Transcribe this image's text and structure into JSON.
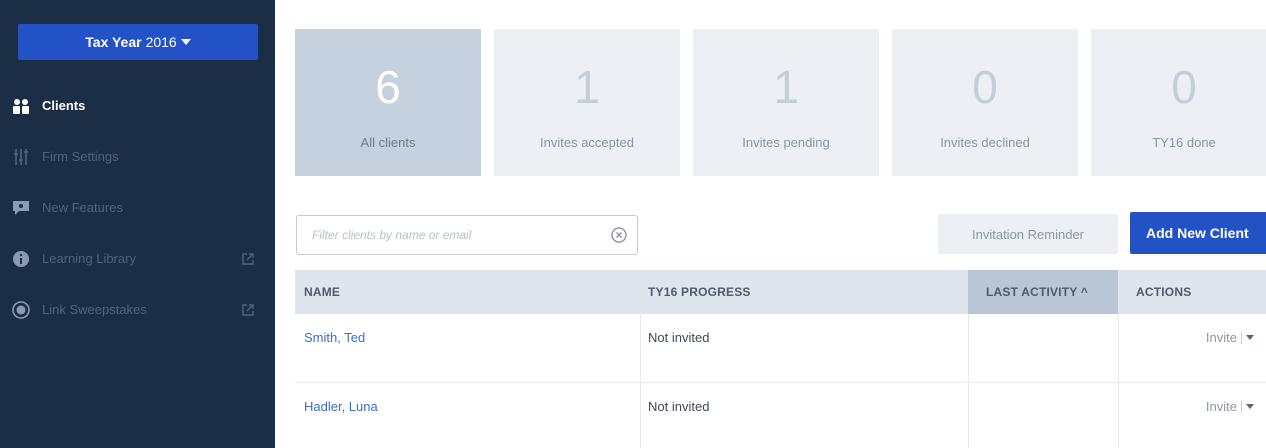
{
  "sidebar": {
    "tax_year_label": "Tax Year",
    "tax_year_value": "2016",
    "items": [
      {
        "label": "Clients",
        "icon": "clients-icon",
        "active": true
      },
      {
        "label": "Firm Settings",
        "icon": "settings-sliders-icon"
      },
      {
        "label": "New Features",
        "icon": "speech-bubble-icon"
      },
      {
        "label": "Learning Library",
        "icon": "info-icon",
        "external": true
      },
      {
        "label": "Link Sweepstakes",
        "icon": "target-icon",
        "external": true
      }
    ]
  },
  "stats": [
    {
      "value": "6",
      "label": "All clients",
      "selected": true
    },
    {
      "value": "1",
      "label": "Invites accepted"
    },
    {
      "value": "1",
      "label": "Invites pending"
    },
    {
      "value": "0",
      "label": "Invites declined"
    },
    {
      "value": "0",
      "label": "TY16 done"
    }
  ],
  "toolbar": {
    "filter_placeholder": "Filter clients by name or email",
    "filter_value": "",
    "reminder_label": "Invitation Reminder",
    "add_label": "Add New Client"
  },
  "table": {
    "columns": [
      {
        "label": "NAME"
      },
      {
        "label": "TY16 PROGRESS"
      },
      {
        "label": "LAST ACTIVITY ^",
        "sorted": true
      },
      {
        "label": "ACTIONS"
      }
    ],
    "rows": [
      {
        "name": "Smith, Ted",
        "progress": "Not invited",
        "last_activity": "",
        "action": "Invite"
      },
      {
        "name": "Hadler, Luna",
        "progress": "Not invited",
        "last_activity": "",
        "action": "Invite"
      }
    ]
  },
  "colors": {
    "sidebar_bg": "#1b2e45",
    "accent": "#2352c6",
    "link": "#3a6fc4",
    "card_bg": "#eceff4",
    "card_selected_bg": "#c6d1df"
  }
}
